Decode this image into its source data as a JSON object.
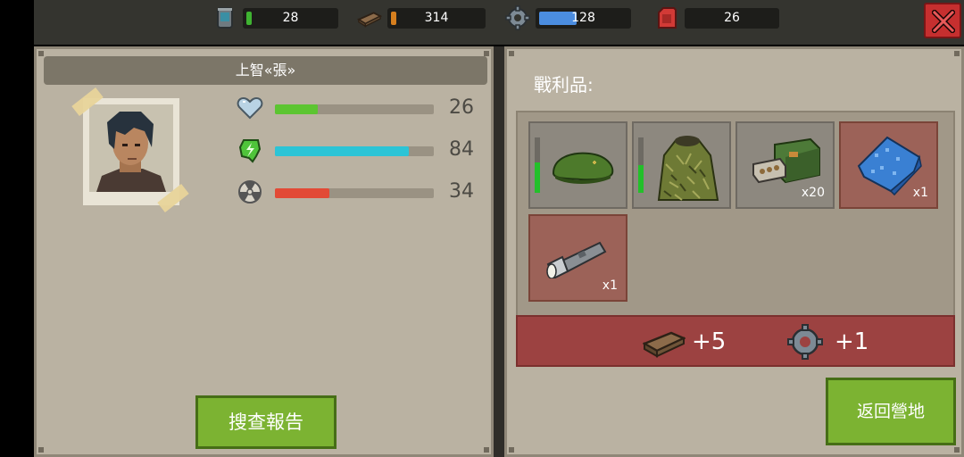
{
  "resources": [
    {
      "icon": "canister-icon",
      "value": "28",
      "fill_color": "#3fb331"
    },
    {
      "icon": "wood-plank-icon",
      "value": "314",
      "fill_color": "#d67f1e"
    },
    {
      "icon": "gear-icon",
      "value": "128",
      "fill_color": "#4b8de0"
    },
    {
      "icon": "fuel-can-icon",
      "value": "26",
      "fill_color": "#c42b2b"
    }
  ],
  "character": {
    "name": "上智«張»",
    "stats": [
      {
        "icon": "heart-icon",
        "value": "26",
        "level": 0.26,
        "color": "#5cc531"
      },
      {
        "icon": "energy-icon",
        "value": "84",
        "level": 0.84,
        "color": "#2cc4d6"
      },
      {
        "icon": "radiation-icon",
        "value": "34",
        "level": 0.34,
        "color": "#e24a36"
      }
    ]
  },
  "report_button": "搜查報告",
  "loot": {
    "title": "戰利品:",
    "items": [
      {
        "icon": "green-beret-icon",
        "count": "",
        "durability": 0.55
      },
      {
        "icon": "ghillie-suit-icon",
        "count": "",
        "durability": 0.5
      },
      {
        "icon": "ammo-box-icon",
        "count": "x20",
        "durability": null
      },
      {
        "icon": "blue-cloth-icon",
        "count": "x1",
        "durability": null
      },
      {
        "icon": "flashlight-icon",
        "count": "x1",
        "durability": null
      }
    ],
    "rewards": [
      {
        "icon": "wood-plank-icon",
        "text": "+5"
      },
      {
        "icon": "gear-icon",
        "text": "+1"
      }
    ]
  },
  "camp_button": "返回營地"
}
